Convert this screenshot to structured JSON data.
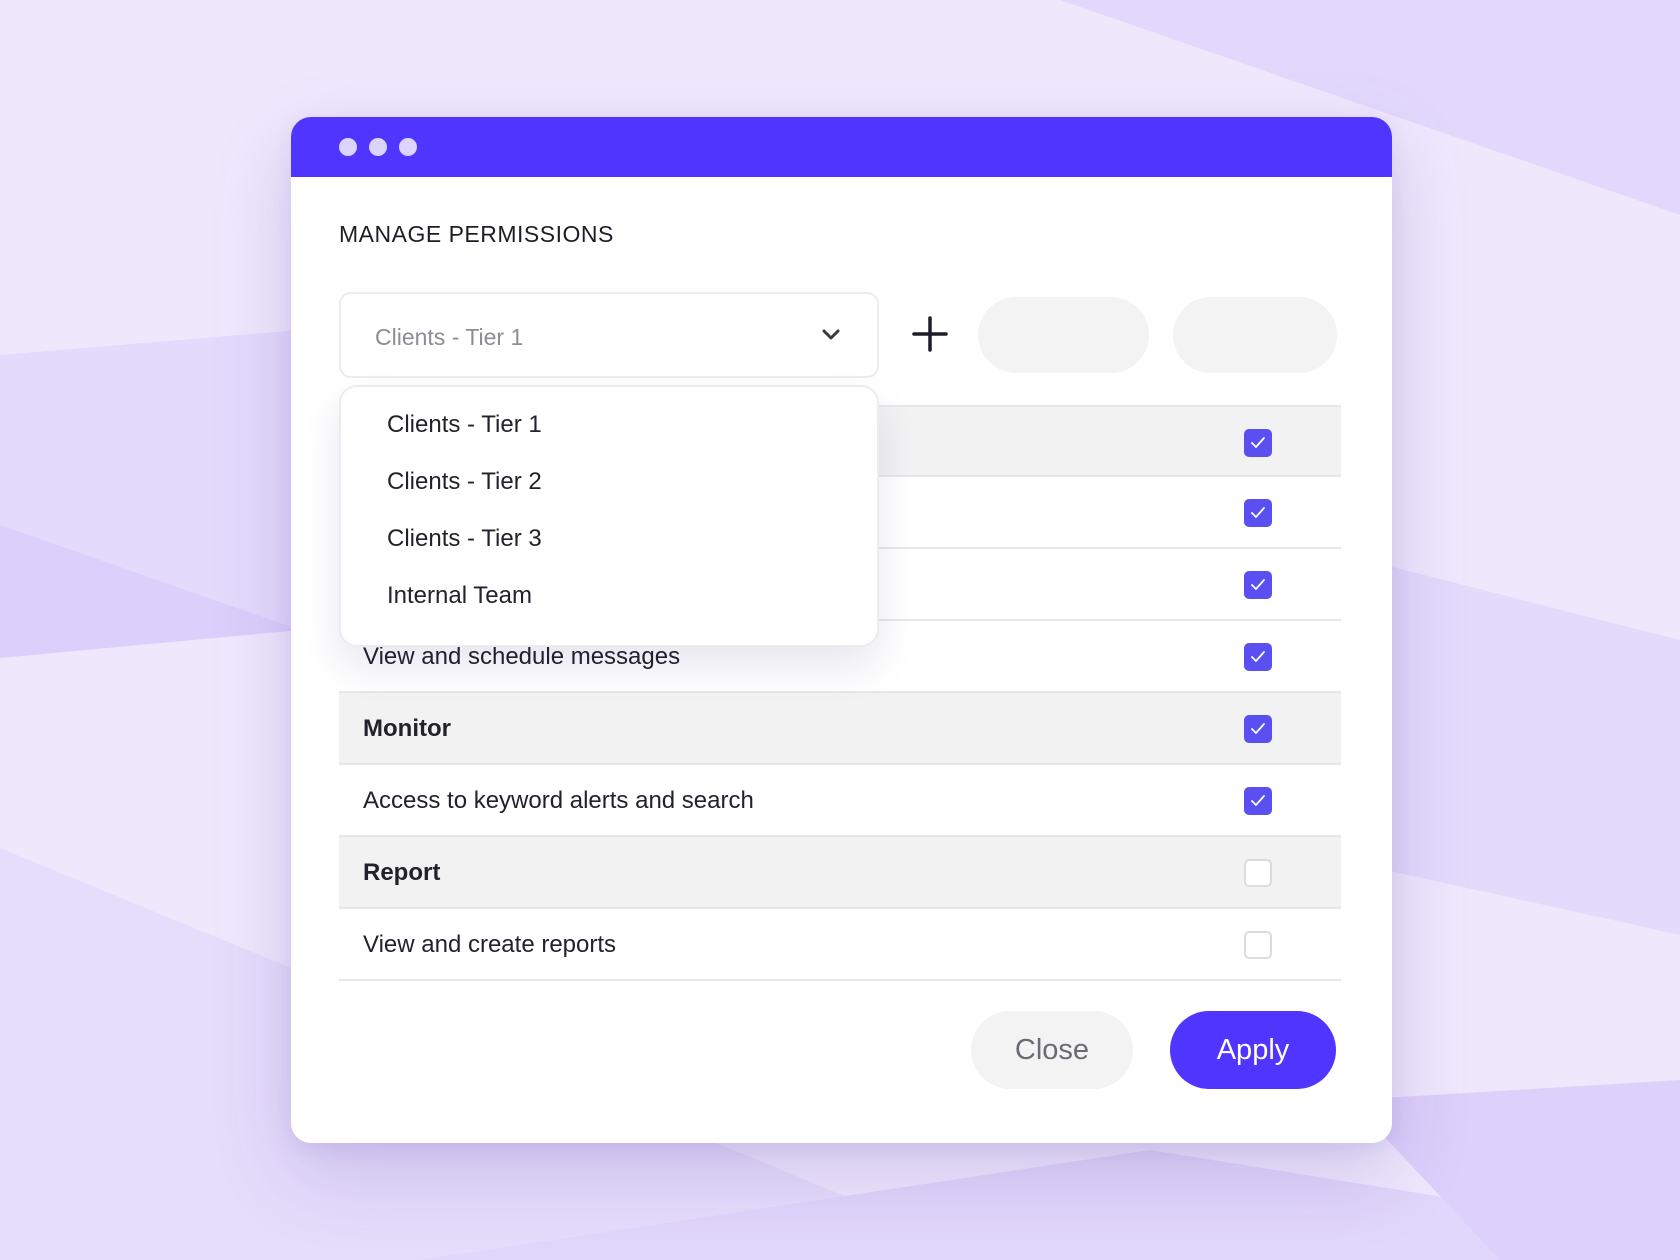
{
  "colors": {
    "accent": "#5034ff",
    "checkbox_on": "#5a4ff0",
    "row_group_bg": "#f2f2f3"
  },
  "window": {
    "title": "MANAGE PERMISSIONS"
  },
  "group_select": {
    "selected": "Clients - Tier 1",
    "options": [
      "Clients - Tier 1",
      "Clients - Tier 2",
      "Clients - Tier 3",
      "Internal Team"
    ]
  },
  "permissions": [
    {
      "label": "",
      "type": "group",
      "checked": true
    },
    {
      "label": "",
      "type": "item",
      "checked": true
    },
    {
      "label": "",
      "type": "item",
      "checked": true
    },
    {
      "label": "View and schedule messages",
      "type": "item",
      "checked": true
    },
    {
      "label": "Monitor",
      "type": "group",
      "checked": true
    },
    {
      "label": "Access to keyword alerts and search",
      "type": "item",
      "checked": true
    },
    {
      "label": "Report",
      "type": "group",
      "checked": false
    },
    {
      "label": "View and create reports",
      "type": "item",
      "checked": false
    }
  ],
  "actions": {
    "close_label": "Close",
    "apply_label": "Apply"
  },
  "icons": {
    "dropdown": "chevron-down-icon",
    "add": "plus-icon",
    "check": "check-icon"
  }
}
